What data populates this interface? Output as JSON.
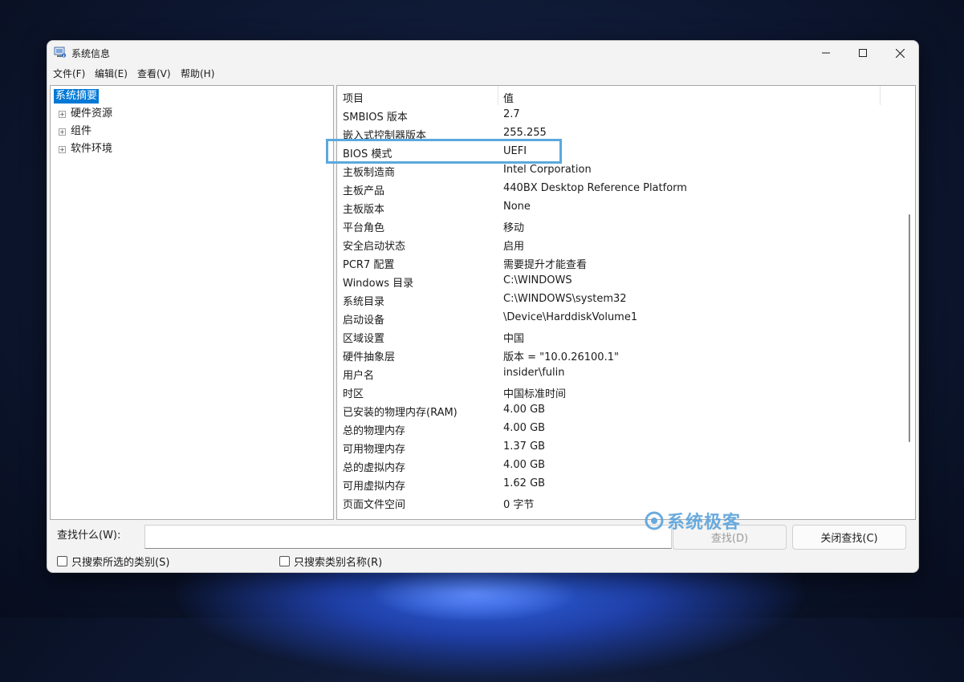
{
  "window": {
    "title": "系统信息",
    "icon": "system-info-icon"
  },
  "menubar": {
    "items": [
      "文件(F)",
      "编辑(E)",
      "查看(V)",
      "帮助(H)"
    ]
  },
  "tree": {
    "root": "系统摘要",
    "children": [
      "硬件资源",
      "组件",
      "软件环境"
    ]
  },
  "table": {
    "headers": [
      "项目",
      "值"
    ],
    "rows": [
      {
        "item": "SMBIOS 版本",
        "value": "2.7"
      },
      {
        "item": "嵌入式控制器版本",
        "value": "255.255"
      },
      {
        "item": "BIOS 模式",
        "value": "UEFI"
      },
      {
        "item": "主板制造商",
        "value": "Intel Corporation"
      },
      {
        "item": "主板产品",
        "value": "440BX Desktop Reference Platform"
      },
      {
        "item": "主板版本",
        "value": "None"
      },
      {
        "item": "平台角色",
        "value": "移动"
      },
      {
        "item": "安全启动状态",
        "value": "启用"
      },
      {
        "item": "PCR7 配置",
        "value": "需要提升才能查看"
      },
      {
        "item": "Windows 目录",
        "value": "C:\\WINDOWS"
      },
      {
        "item": "系统目录",
        "value": "C:\\WINDOWS\\system32"
      },
      {
        "item": "启动设备",
        "value": "\\Device\\HarddiskVolume1"
      },
      {
        "item": "区域设置",
        "value": "中国"
      },
      {
        "item": "硬件抽象层",
        "value": "版本 = \"10.0.26100.1\""
      },
      {
        "item": "用户名",
        "value": "insider\\fulin"
      },
      {
        "item": "时区",
        "value": "中国标准时间"
      },
      {
        "item": "已安装的物理内存(RAM)",
        "value": "4.00 GB"
      },
      {
        "item": "总的物理内存",
        "value": "4.00 GB"
      },
      {
        "item": "可用物理内存",
        "value": "1.37 GB"
      },
      {
        "item": "总的虚拟内存",
        "value": "4.00 GB"
      },
      {
        "item": "可用虚拟内存",
        "value": "1.62 GB"
      },
      {
        "item": "页面文件空间",
        "value": "0 字节"
      }
    ]
  },
  "search": {
    "label": "查找什么(W):",
    "value": "",
    "find_button": "查找(D)",
    "close_button": "关闭查找(C)",
    "option_selected_category": "只搜索所选的类别(S)",
    "option_category_names": "只搜索类别名称(R)"
  },
  "watermark": {
    "text": "系统极客"
  },
  "colors": {
    "selection": "#0078d7",
    "highlight_box": "#5aa9dd",
    "watermark": "#5aa3dc"
  }
}
